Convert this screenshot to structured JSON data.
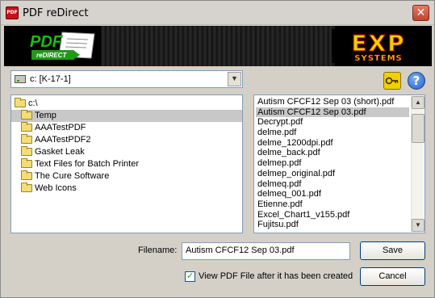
{
  "window": {
    "title": "PDF reDirect",
    "close_glyph": "✕"
  },
  "banner": {
    "logo_text": "PDF",
    "logo_subtext": "reDIRECT",
    "brand_text": "EXP",
    "brand_subtext": "SYSTEMS"
  },
  "drive": {
    "selected": "c: [K-17-1]"
  },
  "icons": {
    "key": "key-icon",
    "help": "help-icon",
    "help_glyph": "?"
  },
  "directories": [
    {
      "label": "c:\\",
      "selected": false
    },
    {
      "label": "Temp",
      "selected": true
    },
    {
      "label": "AAATestPDF",
      "selected": false
    },
    {
      "label": "AAATestPDF2",
      "selected": false
    },
    {
      "label": "Gasket Leak",
      "selected": false
    },
    {
      "label": "Text Files for Batch Printer",
      "selected": false
    },
    {
      "label": "The Cure Software",
      "selected": false
    },
    {
      "label": "Web Icons",
      "selected": false
    }
  ],
  "files": [
    {
      "label": "Autism CFCF12 Sep 03 (short).pdf",
      "selected": false
    },
    {
      "label": "Autism CFCF12 Sep 03.pdf",
      "selected": true
    },
    {
      "label": "Decrypt.pdf",
      "selected": false
    },
    {
      "label": "delme.pdf",
      "selected": false
    },
    {
      "label": "delme_1200dpi.pdf",
      "selected": false
    },
    {
      "label": "delme_back.pdf",
      "selected": false
    },
    {
      "label": "delmep.pdf",
      "selected": false
    },
    {
      "label": "delmep_original.pdf",
      "selected": false
    },
    {
      "label": "delmeq.pdf",
      "selected": false
    },
    {
      "label": "delmeq_001.pdf",
      "selected": false
    },
    {
      "label": "Etienne.pdf",
      "selected": false
    },
    {
      "label": "Excel_Chart1_v155.pdf",
      "selected": false
    },
    {
      "label": "Fujitsu.pdf",
      "selected": false
    }
  ],
  "filename": {
    "label": "Filename:",
    "value": "Autism CFCF12 Sep 03.pdf"
  },
  "buttons": {
    "save": "Save",
    "cancel": "Cancel"
  },
  "view_option": {
    "label": "View PDF File after it has been created",
    "checked": true,
    "check_glyph": "✓"
  },
  "colors": {
    "title_bar": "#d6d3ce",
    "close_button": "#c1432d",
    "selection": "#c8c8c8",
    "folder": "#f6dc74",
    "brand_yellow": "#f0d000",
    "brand_green": "#2fa000"
  }
}
